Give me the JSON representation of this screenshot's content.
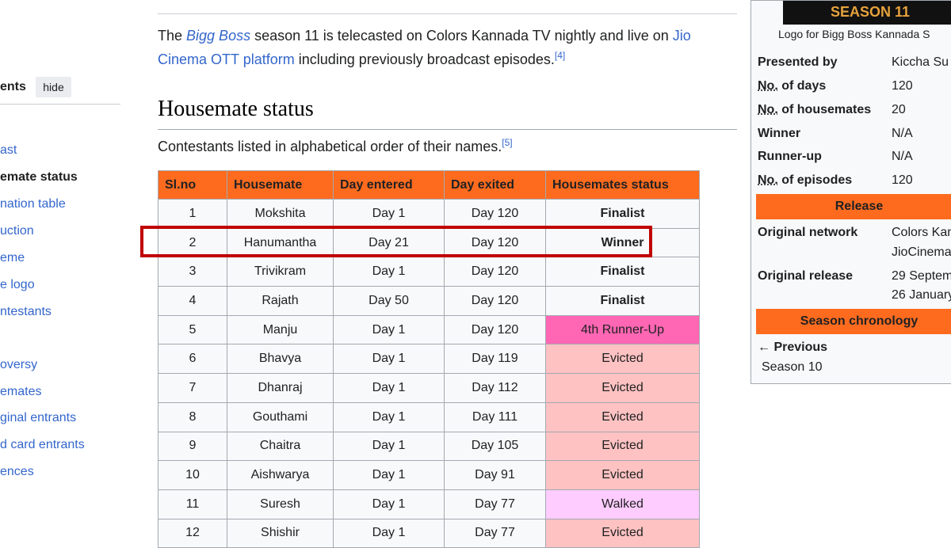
{
  "toc": {
    "title_partial": "ents",
    "hide_label": "hide",
    "items": [
      {
        "label": "ast",
        "active": false
      },
      {
        "label": "emate status",
        "active": true
      },
      {
        "label": "nation table",
        "active": false
      },
      {
        "label": "uction",
        "active": false
      },
      {
        "label": "eme",
        "active": false
      },
      {
        "label": "e logo",
        "active": false
      },
      {
        "label": "ntestants",
        "active": false
      },
      {
        "label": "oversy",
        "active": false
      },
      {
        "label": "emates",
        "active": false
      },
      {
        "label": "ginal entrants",
        "active": false
      },
      {
        "label": "d card entrants",
        "active": false
      },
      {
        "label": "ences",
        "active": false
      }
    ]
  },
  "intro": {
    "text_the": "The ",
    "link_bigg_boss": "Bigg Boss",
    "text_mid": " season 11 is telecasted on Colors Kannada TV nightly and live on ",
    "link_jio": "Jio Cinema OTT platform",
    "text_end": " including previously broadcast episodes.",
    "ref": "[4]"
  },
  "section": {
    "heading": "Housemate status",
    "subtext": "Contestants listed in alphabetical order of their names.",
    "ref": "[5]"
  },
  "table": {
    "headers": [
      "Sl.no",
      "Housemate",
      "Day entered",
      "Day exited",
      "Housemates status"
    ],
    "rows": [
      {
        "no": "1",
        "name": "Mokshita",
        "entered": "Day 1",
        "exited": "Day 120",
        "status": "Finalist",
        "kind": "finalist"
      },
      {
        "no": "2",
        "name": "Hanumantha",
        "entered": "Day 21",
        "exited": "Day 120",
        "status": "Winner",
        "kind": "winner"
      },
      {
        "no": "3",
        "name": "Trivikram",
        "entered": "Day 1",
        "exited": "Day 120",
        "status": "Finalist",
        "kind": "finalist"
      },
      {
        "no": "4",
        "name": "Rajath",
        "entered": "Day 50",
        "exited": "Day 120",
        "status": "Finalist",
        "kind": "finalist"
      },
      {
        "no": "5",
        "name": "Manju",
        "entered": "Day 1",
        "exited": "Day 120",
        "status": "4th Runner-Up",
        "kind": "runnerup"
      },
      {
        "no": "6",
        "name": "Bhavya",
        "entered": "Day 1",
        "exited": "Day 119",
        "status": "Evicted",
        "kind": "evicted"
      },
      {
        "no": "7",
        "name": "Dhanraj",
        "entered": "Day 1",
        "exited": "Day 112",
        "status": "Evicted",
        "kind": "evicted"
      },
      {
        "no": "8",
        "name": "Gouthami",
        "entered": "Day 1",
        "exited": "Day 111",
        "status": "Evicted",
        "kind": "evicted"
      },
      {
        "no": "9",
        "name": "Chaitra",
        "entered": "Day 1",
        "exited": "Day 105",
        "status": "Evicted",
        "kind": "evicted"
      },
      {
        "no": "10",
        "name": "Aishwarya",
        "entered": "Day 1",
        "exited": "Day 91",
        "status": "Evicted",
        "kind": "evicted"
      },
      {
        "no": "11",
        "name": "Suresh",
        "entered": "Day 1",
        "exited": "Day 77",
        "status": "Walked",
        "kind": "walked"
      },
      {
        "no": "12",
        "name": "Shishir",
        "entered": "Day 1",
        "exited": "Day 77",
        "status": "Evicted",
        "kind": "evicted"
      }
    ]
  },
  "infobox": {
    "logo_text": "SEASON 11",
    "logo_caption": "Logo for Bigg Boss Kannada S",
    "presented_by_label": "Presented by",
    "presented_by_value": "Kiccha Su",
    "days_abbr": "No.",
    "days_label": " of days",
    "days_value": "120",
    "housemates_abbr": "No.",
    "housemates_label": " of housemates",
    "housemates_value": "20",
    "winner_label": "Winner",
    "winner_value": "N/A",
    "runnerup_label": "Runner-up",
    "runnerup_value": "N/A",
    "episodes_abbr": "No.",
    "episodes_label": " of episodes",
    "episodes_value": "120",
    "release_header": "Release",
    "network_label": "Original network",
    "network_value_1": "Colors Kan",
    "network_value_2": "JioCinema",
    "orig_release_label": "Original release",
    "orig_release_value_1": "29 Septem",
    "orig_release_value_2": "26 January",
    "chronology_header": "Season chronology",
    "previous_label": "← Previous",
    "previous_link": "Season 10"
  },
  "colors": {
    "header_orange": "#ff6b1e",
    "runnerup_pink": "#ff66b3",
    "evicted_pink": "#ffc2c2",
    "walked_lilac": "#ffccff",
    "highlight_red": "#c00000",
    "link_blue": "#3366cc"
  }
}
